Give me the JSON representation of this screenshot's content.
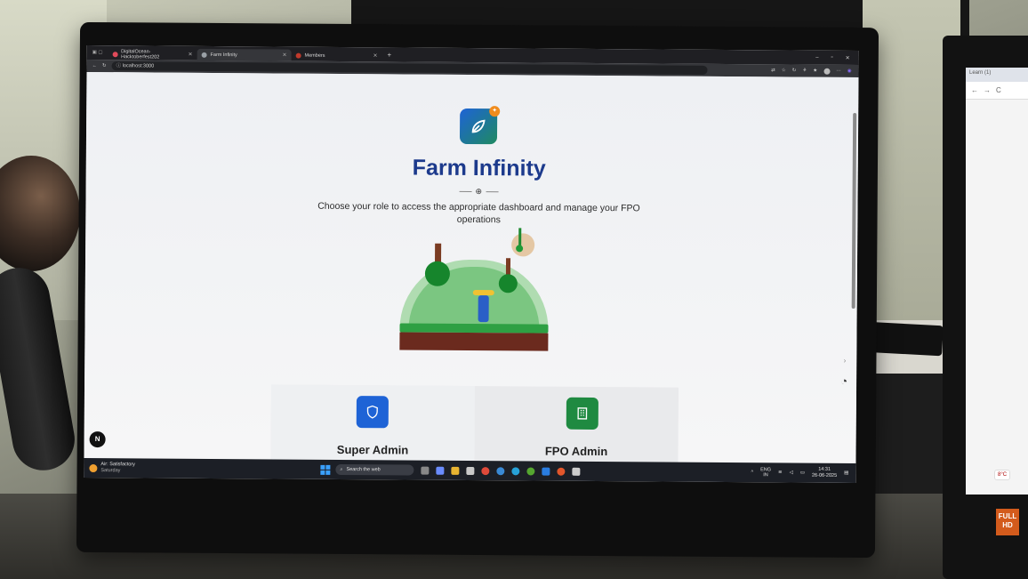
{
  "browser": {
    "tabs": [
      {
        "label": "DigitalOcean-Hacktoberfest202",
        "active": false,
        "favicon_color": "#e04a5a"
      },
      {
        "label": "Farm Infinity",
        "active": true,
        "favicon_color": "#9aa0a6"
      },
      {
        "label": "Members",
        "active": false,
        "favicon_color": "#c0392b"
      }
    ],
    "new_tab_label": "+",
    "url": "localhost:3000",
    "window_controls": [
      "–",
      "▫",
      "✕"
    ]
  },
  "page": {
    "app_title": "Farm Infinity",
    "logo_badge": "✦",
    "subtitle": "Choose your role to access the appropriate dashboard and manage your FPO operations",
    "roles": [
      {
        "label": "Super Admin",
        "icon": "shield-icon",
        "color": "#1e63d6"
      },
      {
        "label": "FPO Admin",
        "icon": "building-icon",
        "color": "#1f8a41"
      }
    ],
    "dev_badge": "N"
  },
  "taskbar": {
    "weather_title": "Air: Satisfactory",
    "weather_day": "Saturday",
    "search_placeholder": "Search the web",
    "lang_top": "ENG",
    "lang_bottom": "IN",
    "time": "14:31",
    "date": "26-06-2025"
  },
  "second_monitor": {
    "tab_label": "Learn (1)",
    "weather_snippet": "8°C"
  },
  "badge": {
    "text": "FULL HD"
  }
}
